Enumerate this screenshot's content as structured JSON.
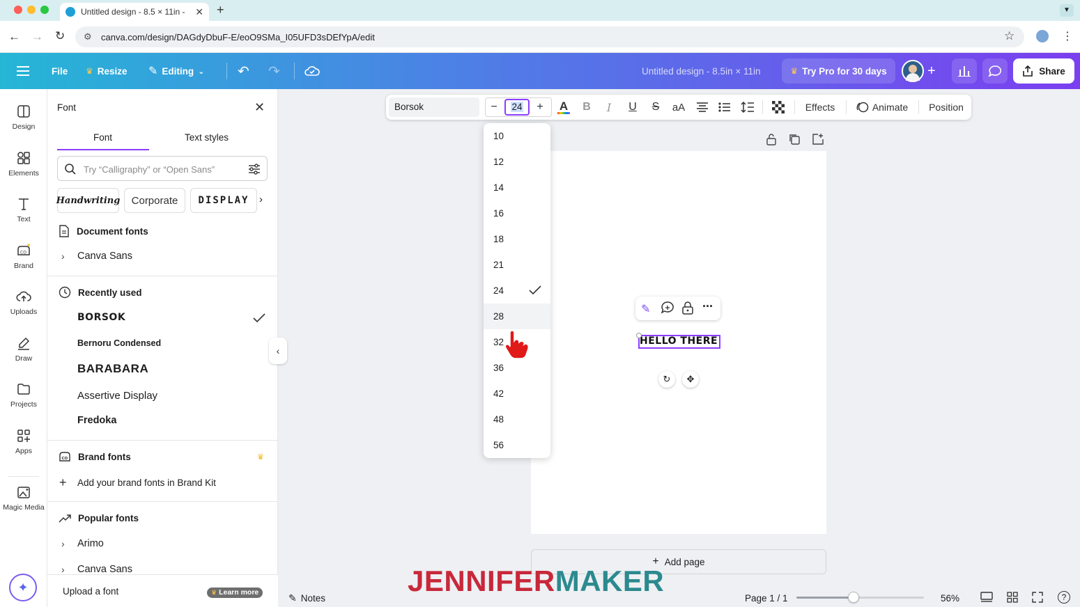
{
  "browser": {
    "tab_title": "Untitled design - 8.5 × 11in -",
    "url": "canva.com/design/DAGdyDbuF-E/eoO9SMa_I05UFD3sDEfYpA/edit"
  },
  "header": {
    "file": "File",
    "resize": "Resize",
    "editing": "Editing",
    "doc_title": "Untitled design - 8.5in × 11in",
    "try_pro": "Try Pro for 30 days",
    "share": "Share"
  },
  "rail": {
    "items": [
      {
        "label": "Design",
        "icon": "design-icon"
      },
      {
        "label": "Elements",
        "icon": "elements-icon"
      },
      {
        "label": "Text",
        "icon": "text-icon"
      },
      {
        "label": "Brand",
        "icon": "brand-icon"
      },
      {
        "label": "Uploads",
        "icon": "uploads-icon"
      },
      {
        "label": "Draw",
        "icon": "draw-icon"
      },
      {
        "label": "Projects",
        "icon": "projects-icon"
      },
      {
        "label": "Apps",
        "icon": "apps-icon"
      },
      {
        "label": "Magic Media",
        "icon": "magic-media-icon"
      }
    ]
  },
  "panel": {
    "title": "Font",
    "tabs": [
      "Font",
      "Text styles"
    ],
    "search_placeholder": "Try “Calligraphy” or “Open Sans”",
    "chips": [
      "Handwriting",
      "Corporate",
      "DISPLAY"
    ],
    "document_fonts": {
      "heading": "Document fonts",
      "items": [
        "Canva Sans"
      ]
    },
    "recently_used": {
      "heading": "Recently used",
      "items": [
        "BORSOK",
        "Bernoru Condensed",
        "BARABARA",
        "Assertive Display",
        "Fredoka"
      ]
    },
    "brand_fonts": {
      "heading": "Brand fonts",
      "add": "Add your brand fonts in Brand Kit"
    },
    "popular_fonts": {
      "heading": "Popular fonts",
      "items": [
        "Arimo",
        "Canva Sans"
      ]
    },
    "upload": "Upload a font",
    "learn_more": "Learn more"
  },
  "toolbar": {
    "font": "Borsok",
    "minus": "−",
    "size": "24",
    "plus": "+",
    "case": "aA",
    "effects": "Effects",
    "animate": "Animate",
    "position": "Position"
  },
  "size_dropdown": {
    "options": [
      "10",
      "12",
      "14",
      "16",
      "18",
      "21",
      "24",
      "28",
      "32",
      "36",
      "42",
      "48",
      "56"
    ],
    "selected": "24",
    "hovered": "28"
  },
  "canvas": {
    "text": "HELLO THERE!",
    "add_page": "Add page"
  },
  "watermark": {
    "part1": "JENNIFER",
    "part2": "MAKER",
    "color1": "#c8283a",
    "color2": "#2b8a8f"
  },
  "bottom": {
    "notes": "Notes",
    "page": "Page 1 / 1",
    "zoom": "56%",
    "zoom_fraction": 0.45
  },
  "colors": {
    "accent": "#8b3dff"
  }
}
